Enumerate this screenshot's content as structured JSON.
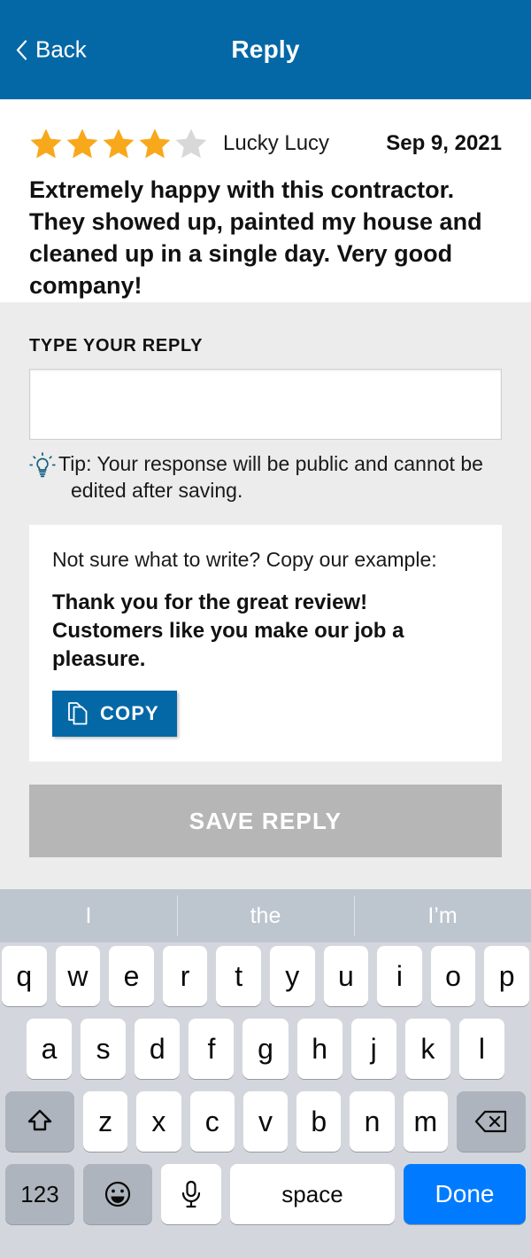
{
  "header": {
    "back_label": "Back",
    "back_icon": "chevron-left-icon",
    "title": "Reply",
    "background_color": "#0568a6"
  },
  "review": {
    "rating": 4,
    "max_rating": 5,
    "star_filled_color": "#F8A81B",
    "star_empty_color": "#d8d8d8",
    "reviewer": "Lucky Lucy",
    "date": "Sep 9, 2021",
    "body": "Extremely happy with this contractor. They showed up, painted my house and cleaned up in a single day. Very good company!"
  },
  "reply": {
    "field_label": "TYPE YOUR REPLY",
    "input_value": "",
    "input_placeholder": "",
    "tip_icon": "lightbulb-icon",
    "tip_line1": "Tip: Your response will be public and cannot be",
    "tip_line2": "edited after saving.",
    "example": {
      "prompt": "Not sure what to write? Copy our example:",
      "text": "Thank you for the great review! Customers like you make our job a pleasure.",
      "copy_label": "COPY",
      "copy_icon": "copy-icon",
      "copy_color": "#0568a6"
    },
    "save_label": "SAVE REPLY",
    "save_enabled": false,
    "save_color": "#b6b6b6"
  },
  "keyboard": {
    "suggestions": [
      "I",
      "the",
      "I’m"
    ],
    "row1": [
      "q",
      "w",
      "e",
      "r",
      "t",
      "y",
      "u",
      "i",
      "o",
      "p"
    ],
    "row2": [
      "a",
      "s",
      "d",
      "f",
      "g",
      "h",
      "j",
      "k",
      "l"
    ],
    "row3": [
      "z",
      "x",
      "c",
      "v",
      "b",
      "n",
      "m"
    ],
    "shift_icon": "shift-icon",
    "backspace_icon": "backspace-icon",
    "numbers_key": "123",
    "emoji_icon": "emoji-icon",
    "mic_icon": "microphone-icon",
    "space_label": "space",
    "done_label": "Done",
    "done_color": "#007AFF"
  }
}
